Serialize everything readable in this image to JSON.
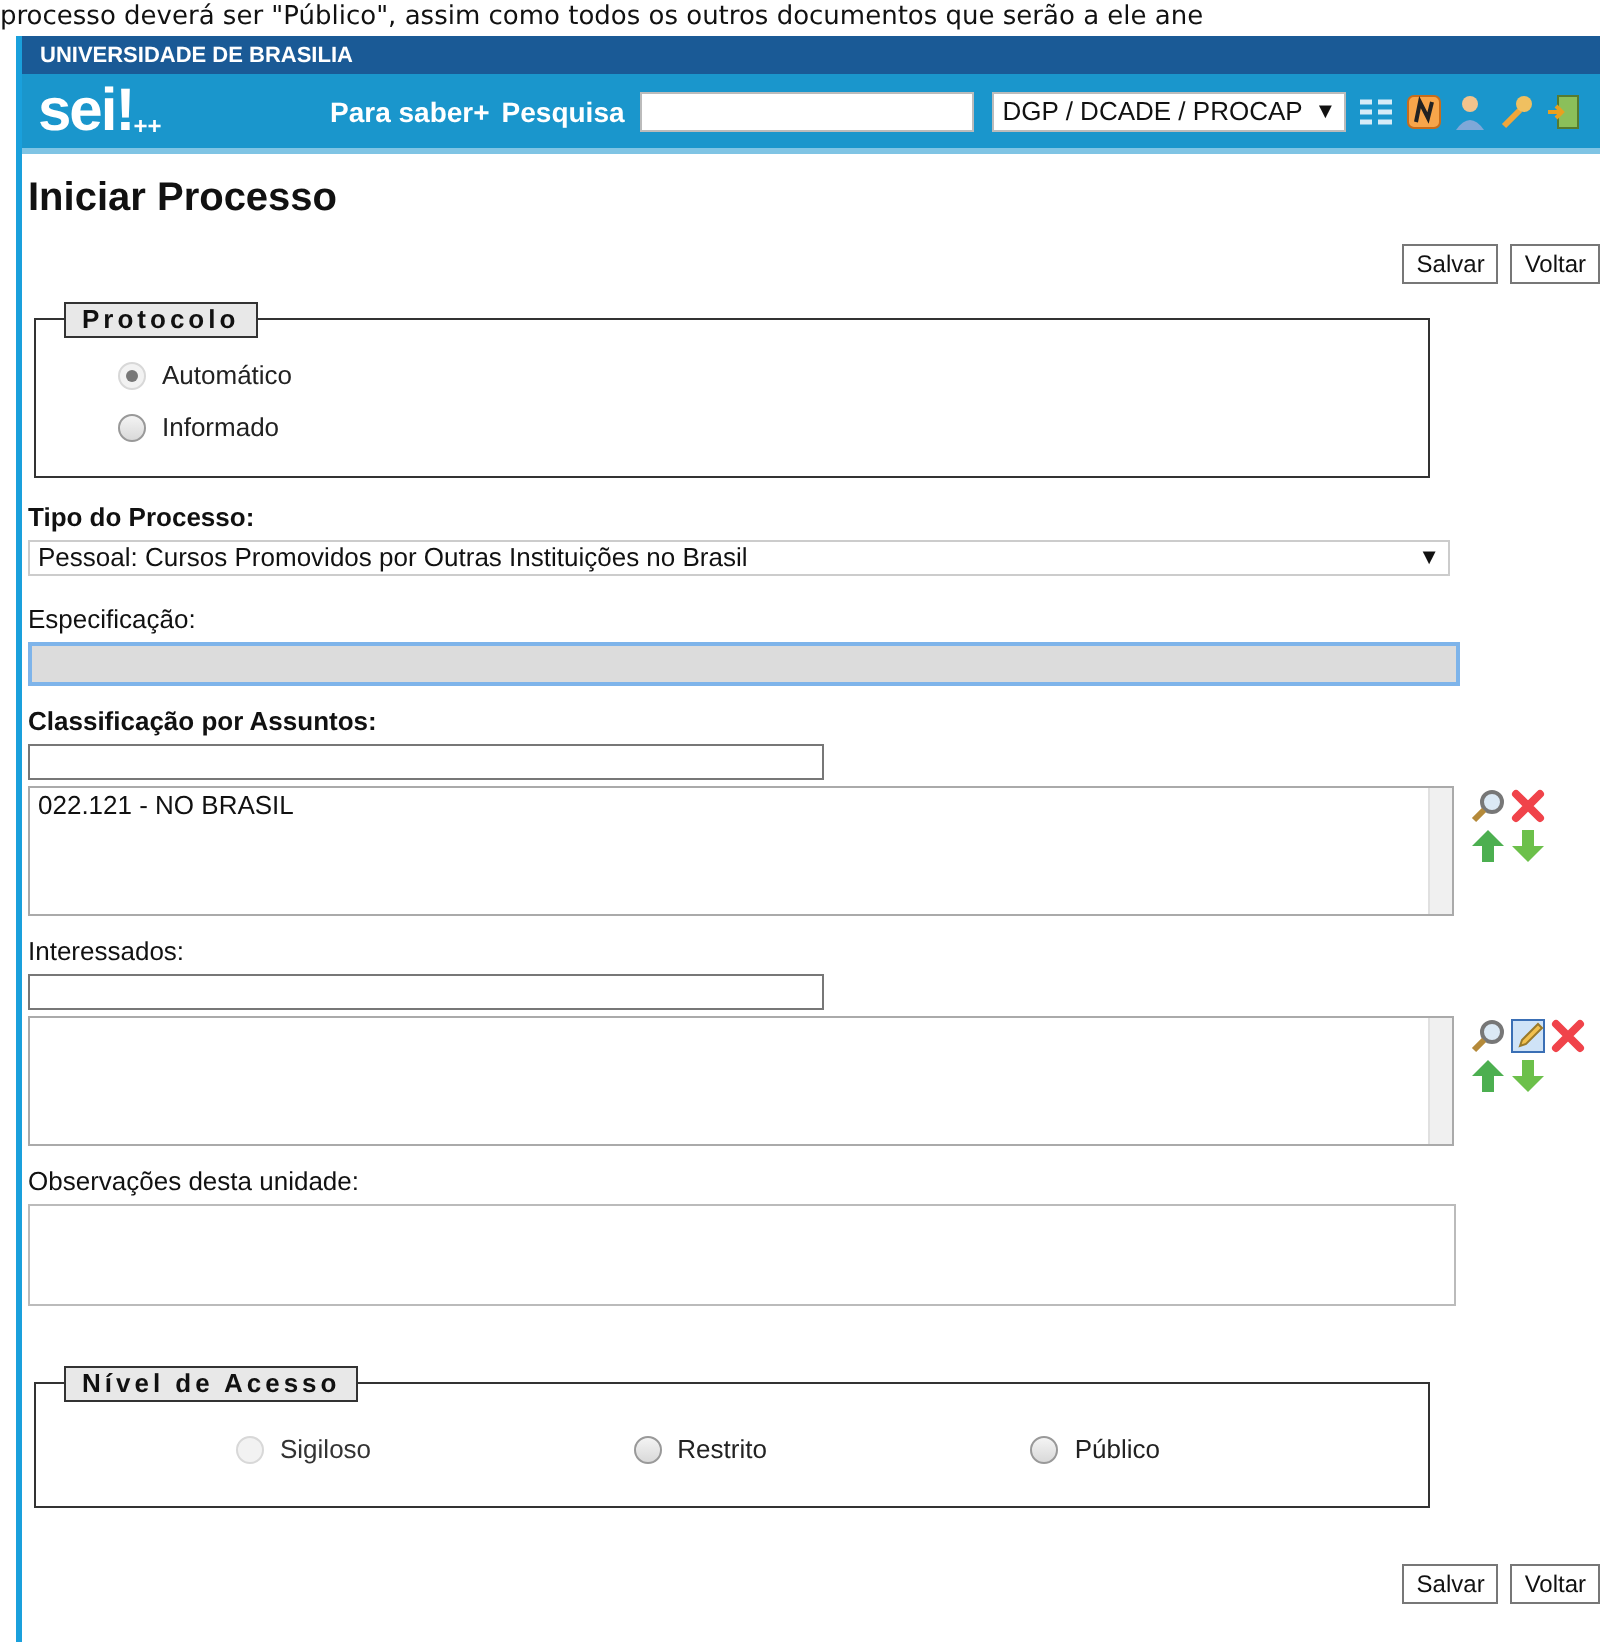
{
  "document_line": "processo deverá ser \"Público\", assim como todos os outros documentos que serão a ele ane",
  "header": {
    "institution": "UNIVERSIDADE DE BRASILIA",
    "logo": "sei!",
    "logo_suffix": "++",
    "links": [
      "Para saber+",
      "Pesquisa"
    ],
    "unit": "DGP / DCADE / PROCAP",
    "unit_caret": "▼"
  },
  "page_title": "Iniciar Processo",
  "top_buttons": [
    "Salvar",
    "Voltar"
  ],
  "protocolo": {
    "legend": "Protocolo",
    "options": [
      {
        "label": "Automático",
        "selected": true,
        "disabled": true
      },
      {
        "label": "Informado",
        "selected": false,
        "disabled": false
      }
    ]
  },
  "tipo": {
    "label": "Tipo do Processo:",
    "value": "Pessoal: Cursos Promovidos por Outras Instituições no Brasil",
    "caret": "▼"
  },
  "especificacao": {
    "label": "Especificação:",
    "disabled": true
  },
  "classificacao": {
    "label": "Classificação por Assuntos:",
    "items": [
      "022.121 - NO BRASIL"
    ]
  },
  "interessados": {
    "label": "Interessados:"
  },
  "observacoes": {
    "label": "Observações desta unidade:"
  },
  "nivel": {
    "legend": "Nível de Acesso",
    "options": [
      {
        "label": "Sigiloso",
        "selected": false,
        "disabled": true
      },
      {
        "label": "Restrito",
        "selected": false,
        "disabled": false
      },
      {
        "label": "Público",
        "selected": false,
        "disabled": false
      }
    ]
  },
  "bottom_buttons": [
    "Salvar",
    "Voltar"
  ]
}
